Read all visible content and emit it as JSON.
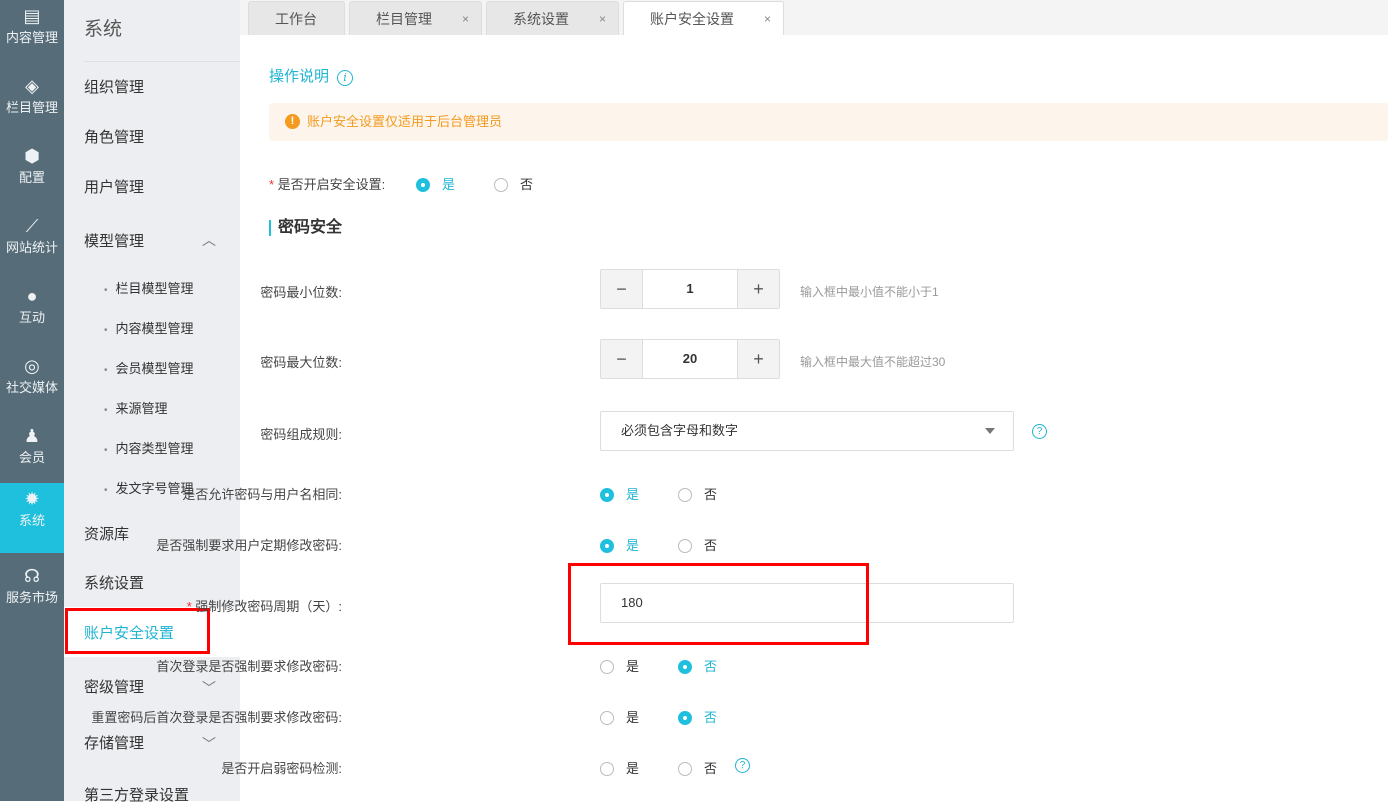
{
  "rail": [
    {
      "label": "内容管理",
      "icon": "document-icon"
    },
    {
      "label": "栏目管理",
      "icon": "layers-icon"
    },
    {
      "label": "配置",
      "icon": "box-icon"
    },
    {
      "label": "网站统计",
      "icon": "chart-icon"
    },
    {
      "label": "互动",
      "icon": "chat-icon"
    },
    {
      "label": "社交媒体",
      "icon": "social-icon"
    },
    {
      "label": "会员",
      "icon": "member-icon"
    },
    {
      "label": "系统",
      "icon": "gear-icon"
    },
    {
      "label": "服务市场",
      "icon": "headset-icon"
    }
  ],
  "sidebar": {
    "title": "系统",
    "items": [
      "组织管理",
      "角色管理",
      "用户管理",
      "模型管理"
    ],
    "sub": [
      "栏目模型管理",
      "内容模型管理",
      "会员模型管理",
      "来源管理",
      "内容类型管理",
      "发文字号管理"
    ],
    "after": [
      "资源库",
      "系统设置",
      "账户安全设置",
      "密级管理",
      "存储管理",
      "第三方登录设置"
    ]
  },
  "tabs": [
    "工作台",
    "栏目管理",
    "系统设置",
    "账户安全设置"
  ],
  "main": {
    "help": "操作说明",
    "notice": "账户安全设置仅适用于后台管理员",
    "enable_label": "是否开启安全设置:",
    "yes": "是",
    "no": "否",
    "section": "密码安全",
    "min_label": "密码最小位数:",
    "min_value": "1",
    "min_hint": "输入框中最小值不能小于1",
    "max_label": "密码最大位数:",
    "max_value": "20",
    "max_hint": "输入框中最大值不能超过30",
    "rule_label": "密码组成规则:",
    "rule_value": "必须包含字母和数字",
    "same_label": "是否允许密码与用户名相同:",
    "force_label": "是否强制要求用户定期修改密码:",
    "period_label": "强制修改密码周期（天）:",
    "period_value": "180",
    "first_label": "首次登录是否强制要求修改密码:",
    "reset_label": "重置密码后首次登录是否强制要求修改密码:",
    "weak_label": "是否开启弱密码检测:"
  }
}
